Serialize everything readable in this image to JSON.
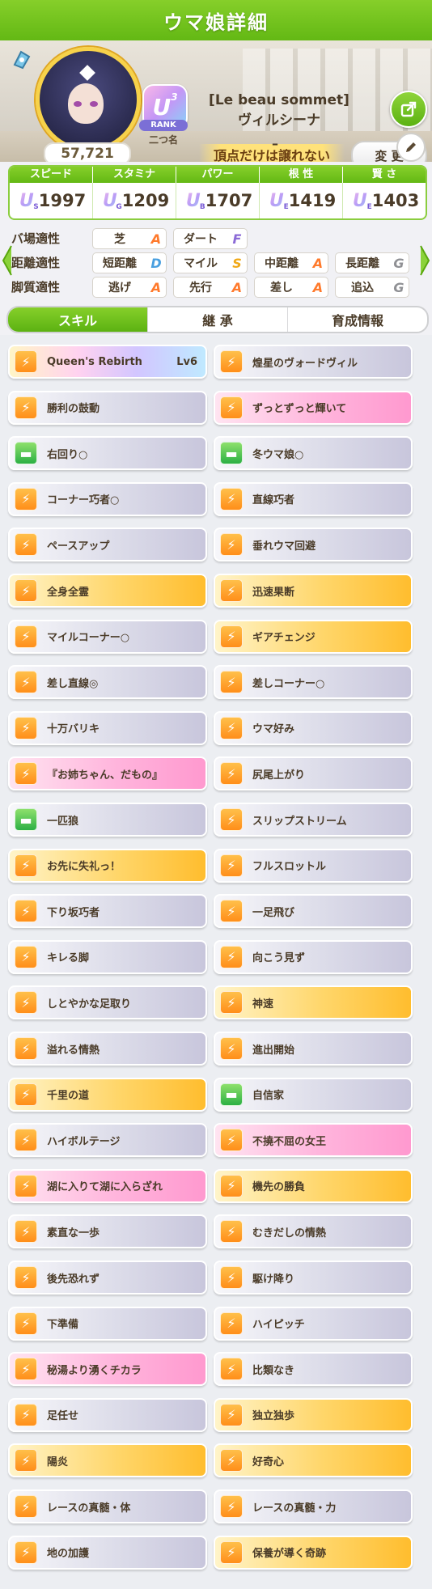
{
  "header": {
    "title": "ウマ娘詳細"
  },
  "profile": {
    "fans": "57,721",
    "rank_letter": "U",
    "rank_super": "3",
    "rank_label": "RANK",
    "alias_label": "二つ名",
    "title_en": "[Le beau sommet]",
    "name": "ヴィルシーナ",
    "motto": "頂点だけは譲れない",
    "change_label": "変 更",
    "dash": "–"
  },
  "stats": {
    "headers": [
      "スピード",
      "スタミナ",
      "パワー",
      "根 性",
      "賢 さ"
    ],
    "grades": [
      {
        "letter": "U",
        "sub": "S"
      },
      {
        "letter": "U",
        "sub": "G"
      },
      {
        "letter": "U",
        "sub": "B"
      },
      {
        "letter": "U",
        "sub": "E"
      },
      {
        "letter": "U",
        "sub": "E"
      }
    ],
    "values": [
      "1997",
      "1209",
      "1707",
      "1419",
      "1403"
    ]
  },
  "aptitude": {
    "track": {
      "label": "バ場適性",
      "cells": [
        {
          "name": "芝",
          "grade": "A"
        },
        {
          "name": "ダート",
          "grade": "F"
        }
      ]
    },
    "distance": {
      "label": "距離適性",
      "cells": [
        {
          "name": "短距離",
          "grade": "D"
        },
        {
          "name": "マイル",
          "grade": "S"
        },
        {
          "name": "中距離",
          "grade": "A"
        },
        {
          "name": "長距離",
          "grade": "G"
        }
      ]
    },
    "style": {
      "label": "脚質適性",
      "cells": [
        {
          "name": "逃げ",
          "grade": "A"
        },
        {
          "name": "先行",
          "grade": "A"
        },
        {
          "name": "差し",
          "grade": "A"
        },
        {
          "name": "追込",
          "grade": "G"
        }
      ]
    }
  },
  "grade_colors": {
    "S": "#f0a817",
    "A": "#ff7a2c",
    "B": "#e84f7c",
    "D": "#4aa0e0",
    "F": "#8b6ad6",
    "G": "#8f9094"
  },
  "tabs": [
    "スキル",
    "継 承",
    "育成情報"
  ],
  "skills": [
    {
      "name": "Queen's Rebirth",
      "lv": "Lv6",
      "style": "unique",
      "icon": "orange"
    },
    {
      "name": "煌星のヴォードヴィル",
      "style": "white",
      "icon": "orange"
    },
    {
      "name": "勝利の鼓動",
      "style": "white",
      "icon": "orange"
    },
    {
      "name": "ずっとずっと輝いて",
      "style": "pink",
      "icon": "orange"
    },
    {
      "name": "右回り○",
      "style": "white",
      "icon": "green"
    },
    {
      "name": "冬ウマ娘○",
      "style": "white",
      "icon": "green"
    },
    {
      "name": "コーナー巧者○",
      "style": "white",
      "icon": "orange"
    },
    {
      "name": "直線巧者",
      "style": "white",
      "icon": "orange"
    },
    {
      "name": "ペースアップ",
      "style": "white",
      "icon": "orange"
    },
    {
      "name": "垂れウマ回避",
      "style": "white",
      "icon": "orange"
    },
    {
      "name": "全身全霊",
      "style": "gold",
      "icon": "orange"
    },
    {
      "name": "迅速果断",
      "style": "gold",
      "icon": "orange"
    },
    {
      "name": "マイルコーナー○",
      "style": "white",
      "icon": "orange"
    },
    {
      "name": "ギアチェンジ",
      "style": "gold",
      "icon": "orange"
    },
    {
      "name": "差し直線◎",
      "style": "white",
      "icon": "orange"
    },
    {
      "name": "差しコーナー○",
      "style": "white",
      "icon": "orange"
    },
    {
      "name": "十万バリキ",
      "style": "white",
      "icon": "orange"
    },
    {
      "name": "ウマ好み",
      "style": "white",
      "icon": "orange"
    },
    {
      "name": "『お姉ちゃん、だもの』",
      "style": "pink",
      "icon": "orange"
    },
    {
      "name": "尻尾上がり",
      "style": "white",
      "icon": "orange"
    },
    {
      "name": "一匹狼",
      "style": "white",
      "icon": "green"
    },
    {
      "name": "スリップストリーム",
      "style": "white",
      "icon": "orange"
    },
    {
      "name": "お先に失礼っ！",
      "style": "gold",
      "icon": "orange"
    },
    {
      "name": "フルスロットル",
      "style": "white",
      "icon": "orange"
    },
    {
      "name": "下り坂巧者",
      "style": "white",
      "icon": "orange"
    },
    {
      "name": "一足飛び",
      "style": "white",
      "icon": "orange"
    },
    {
      "name": "キレる脚",
      "style": "white",
      "icon": "orange"
    },
    {
      "name": "向こう見ず",
      "style": "white",
      "icon": "orange"
    },
    {
      "name": "しとやかな足取り",
      "style": "white",
      "icon": "orange"
    },
    {
      "name": "神速",
      "style": "gold",
      "icon": "orange"
    },
    {
      "name": "溢れる情熱",
      "style": "white",
      "icon": "orange"
    },
    {
      "name": "進出開始",
      "style": "white",
      "icon": "orange"
    },
    {
      "name": "千里の道",
      "style": "gold",
      "icon": "orange"
    },
    {
      "name": "自信家",
      "style": "white",
      "icon": "green"
    },
    {
      "name": "ハイボルテージ",
      "style": "white",
      "icon": "orange"
    },
    {
      "name": "不撓不屈の女王",
      "style": "pink",
      "icon": "orange"
    },
    {
      "name": "湖に入りて湖に入らざれ",
      "style": "pink",
      "icon": "orange"
    },
    {
      "name": "機先の勝負",
      "style": "gold",
      "icon": "orange"
    },
    {
      "name": "素直な一歩",
      "style": "white",
      "icon": "orange"
    },
    {
      "name": "むきだしの情熱",
      "style": "white",
      "icon": "orange"
    },
    {
      "name": "後先恐れず",
      "style": "white",
      "icon": "orange"
    },
    {
      "name": "駆け降り",
      "style": "white",
      "icon": "orange"
    },
    {
      "name": "下準備",
      "style": "white",
      "icon": "orange"
    },
    {
      "name": "ハイピッチ",
      "style": "white",
      "icon": "orange"
    },
    {
      "name": "秘湯より湧くチカラ",
      "style": "pink",
      "icon": "orange"
    },
    {
      "name": "比類なき",
      "style": "white",
      "icon": "orange"
    },
    {
      "name": "足任せ",
      "style": "white",
      "icon": "orange"
    },
    {
      "name": "独立独歩",
      "style": "gold",
      "icon": "orange"
    },
    {
      "name": "陽炎",
      "style": "gold",
      "icon": "orange"
    },
    {
      "name": "好奇心",
      "style": "gold",
      "icon": "orange"
    },
    {
      "name": "レースの真髄・体",
      "style": "white",
      "icon": "orange"
    },
    {
      "name": "レースの真髄・力",
      "style": "white",
      "icon": "orange"
    },
    {
      "name": "地の加護",
      "style": "white",
      "icon": "orange"
    },
    {
      "name": "保養が導く奇跡",
      "style": "gold",
      "icon": "orange"
    }
  ]
}
